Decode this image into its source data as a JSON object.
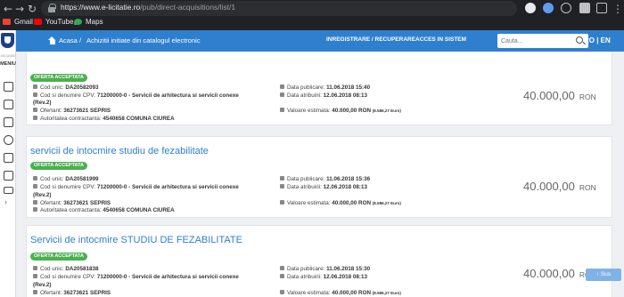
{
  "browser": {
    "url_host": "https://www.e-licitatie.ro",
    "url_path": "/pub/direct-acquisitions/list/1",
    "bookmarks": [
      "Gmail",
      "YouTube",
      "Maps"
    ]
  },
  "sidebar": {
    "menu_small": "ASCUNDE",
    "menu_label": "MENIU",
    "arrow": "›"
  },
  "header": {
    "home": "Acasa",
    "sep": "/",
    "crumb": "Achizitii initiate din catalogul electronic",
    "register": "INREGISTRARE / RECUPERARE",
    "login": "ACCES IN SISTEM",
    "search_placeholder": "Cauta...",
    "lang": "RO | EN"
  },
  "cards": [
    {
      "title": "",
      "badge": "OFERTA ACCEPTATA",
      "cod_label": "Cod unic: ",
      "cod": "DA20582093",
      "cpv_label": "Cod si denumire CPV: ",
      "cpv": "71200000-0 - Servicii de arhitectura si servicii conexe",
      "cpv2": "(Rev.2)",
      "ofertant_label": "Ofertant: ",
      "ofertant": "36273621 SEPRIS",
      "autoritate_label": "Autoritatea contractanta: ",
      "autoritate": "4540658 COMUNA CIUREA",
      "data_pub_label": "Data publicare: ",
      "data_pub": "11.06.2018 15:40",
      "data_atr_label": "Data atribuirii: ",
      "data_atr": "12.06.2018 08:13",
      "valoare_label": "Valoare estimata: ",
      "valoare": "40.000,00  RON",
      "valoare_eur": "(8.586,27  Euro)",
      "price": "40.000,00",
      "currency": "RON"
    },
    {
      "title": "servicii de intocmire studiu de fezabilitate",
      "badge": "OFERTA ACCEPTATA",
      "cod_label": "Cod unic: ",
      "cod": "DA20581999",
      "cpv_label": "Cod si denumire CPV: ",
      "cpv": "71200000-0 - Servicii de arhitectura si servicii conexe",
      "cpv2": "(Rev.2)",
      "ofertant_label": "Ofertant: ",
      "ofertant": "36273621 SEPRIS",
      "autoritate_label": "Autoritatea contractanta: ",
      "autoritate": "4540658 COMUNA CIUREA",
      "data_pub_label": "Data publicare: ",
      "data_pub": "11.06.2018 15:36",
      "data_atr_label": "Data atribuirii: ",
      "data_atr": "12.06.2018 08:13",
      "valoare_label": "Valoare estimata: ",
      "valoare": "40.000,00  RON",
      "valoare_eur": "(8.586,27  Euro)",
      "price": "40.000,00",
      "currency": "RON"
    },
    {
      "title": "Servicii de intocmire STUDIU DE FEZABILITATE",
      "badge": "OFERTA ACCEPTATA",
      "cod_label": "Cod unic: ",
      "cod": "DA20581838",
      "cpv_label": "Cod si denumire CPV: ",
      "cpv": "71200000-0 - Servicii de arhitectura si servicii conexe",
      "cpv2": "(Rev.2)",
      "ofertant_label": "Ofertant: ",
      "ofertant": "36273621 SEPRIS",
      "autoritate_label": "",
      "autoritate": "",
      "data_pub_label": "Data publicare: ",
      "data_pub": "11.06.2018 15:30",
      "data_atr_label": "Data atribuirii: ",
      "data_atr": "12.06.2018 08:13",
      "valoare_label": "Valoare estimata: ",
      "valoare": "40.000,00  RON",
      "valoare_eur": "(8.586,27  Euro)",
      "price": "40.000,00",
      "currency": "RON"
    }
  ],
  "scroll_top": "Sus",
  "colors": {
    "header": "#2f7fcf",
    "badge": "#4caf50",
    "link": "#2f7fcf",
    "chrome": "#202124"
  }
}
